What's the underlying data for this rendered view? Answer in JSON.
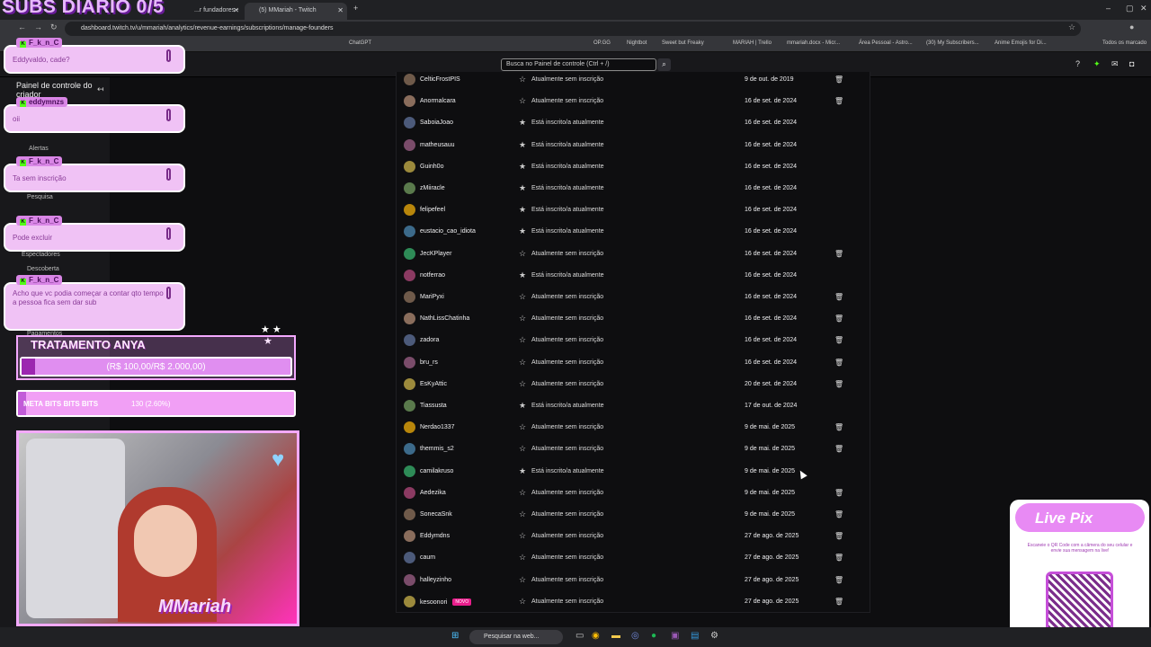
{
  "browser": {
    "tabs": [
      {
        "label": "...r fundadores - Twi"
      },
      {
        "label": "(5) MMariah - Twitch"
      }
    ],
    "url": "dashboard.twitch.tv/u/mmariah/analytics/revenue-earnings/subscriptions/manage-founders",
    "bookmarks": [
      "ChatGPT",
      "OP.GG",
      "Nightbot",
      "Sweet but Freaky",
      "MARIAH | Trello",
      "mmariah.docx - Micr...",
      "Área Pessoal - Astro...",
      "(30) My Subscribers...",
      "Anime Emojis for Di...",
      "Todos os marcado"
    ]
  },
  "dashboard": {
    "search_placeholder": "Busca no Painel de controle (Ctrl + /)",
    "sidebar": {
      "title": "Painel de controle do criador",
      "items": [
        "Alertas",
        "Pesquisa",
        "Espectadores",
        "Descoberta",
        "Pagamentos"
      ]
    },
    "rows": [
      {
        "name": "CelticFrostPIS",
        "status": "Atualmente sem inscrição",
        "date": "9 de out. de 2019",
        "filled": false,
        "trash": true
      },
      {
        "name": "Anormalcara",
        "status": "Atualmente sem inscrição",
        "date": "16 de set. de 2024",
        "filled": false,
        "trash": true
      },
      {
        "name": "SaboiaJoao",
        "status": "Está inscrito/a atualmente",
        "date": "16 de set. de 2024",
        "filled": true,
        "trash": false
      },
      {
        "name": "matheusauu",
        "status": "Está inscrito/a atualmente",
        "date": "16 de set. de 2024",
        "filled": true,
        "trash": false
      },
      {
        "name": "Guinh0o",
        "status": "Está inscrito/a atualmente",
        "date": "16 de set. de 2024",
        "filled": true,
        "trash": false
      },
      {
        "name": "zMiiracle",
        "status": "Está inscrito/a atualmente",
        "date": "16 de set. de 2024",
        "filled": true,
        "trash": false
      },
      {
        "name": "felipefeel",
        "status": "Está inscrito/a atualmente",
        "date": "16 de set. de 2024",
        "filled": true,
        "trash": false
      },
      {
        "name": "eustacio_cao_idiota",
        "status": "Está inscrito/a atualmente",
        "date": "16 de set. de 2024",
        "filled": true,
        "trash": false
      },
      {
        "name": "JecKPlayer",
        "status": "Atualmente sem inscrição",
        "date": "16 de set. de 2024",
        "filled": false,
        "trash": true
      },
      {
        "name": "notferrao",
        "status": "Está inscrito/a atualmente",
        "date": "16 de set. de 2024",
        "filled": true,
        "trash": false
      },
      {
        "name": "MariPyxi",
        "status": "Atualmente sem inscrição",
        "date": "16 de set. de 2024",
        "filled": false,
        "trash": true
      },
      {
        "name": "NathLissChatinha",
        "status": "Atualmente sem inscrição",
        "date": "16 de set. de 2024",
        "filled": false,
        "trash": true
      },
      {
        "name": "zadora",
        "status": "Atualmente sem inscrição",
        "date": "16 de set. de 2024",
        "filled": false,
        "trash": true
      },
      {
        "name": "bru_rs",
        "status": "Atualmente sem inscrição",
        "date": "16 de set. de 2024",
        "filled": false,
        "trash": true
      },
      {
        "name": "EsKyAttic",
        "status": "Atualmente sem inscrição",
        "date": "20 de set. de 2024",
        "filled": false,
        "trash": true
      },
      {
        "name": "Tiassusta",
        "status": "Está inscrito/a atualmente",
        "date": "17 de out. de 2024",
        "filled": true,
        "trash": false
      },
      {
        "name": "Nerdao1337",
        "status": "Atualmente sem inscrição",
        "date": "9 de mai. de 2025",
        "filled": false,
        "trash": true
      },
      {
        "name": "themmis_s2",
        "status": "Atualmente sem inscrição",
        "date": "9 de mai. de 2025",
        "filled": false,
        "trash": true
      },
      {
        "name": "camilakruso",
        "status": "Está inscrito/a atualmente",
        "date": "9 de mai. de 2025",
        "filled": true,
        "trash": false
      },
      {
        "name": "Aedezika",
        "status": "Atualmente sem inscrição",
        "date": "9 de mai. de 2025",
        "filled": false,
        "trash": true
      },
      {
        "name": "SonecaSnk",
        "status": "Atualmente sem inscrição",
        "date": "9 de mai. de 2025",
        "filled": false,
        "trash": true
      },
      {
        "name": "Eddymdns",
        "status": "Atualmente sem inscrição",
        "date": "27 de ago. de 2025",
        "filled": false,
        "trash": true
      },
      {
        "name": "caum",
        "status": "Atualmente sem inscrição",
        "date": "27 de ago. de 2025",
        "filled": false,
        "trash": true
      },
      {
        "name": "halleyzinho",
        "status": "Atualmente sem inscrição",
        "date": "27 de ago. de 2025",
        "filled": false,
        "trash": true
      },
      {
        "name": "kesoonori",
        "badge": "NOVO",
        "status": "Atualmente sem inscrição",
        "date": "27 de ago. de 2025",
        "filled": false,
        "trash": true
      }
    ]
  },
  "overlay": {
    "title": "SUBS DIÁRIO 0/5",
    "chat": [
      {
        "user": "F_k_n_C",
        "text": "Eddyvaldo, cade?"
      },
      {
        "user": "eddymnzs",
        "text": "oii"
      },
      {
        "user": "F_k_n_C",
        "text": "Ta sem inscrição"
      },
      {
        "user": "F_k_n_C",
        "text": "Pode excluir"
      },
      {
        "user": "F_k_n_C",
        "text": "Acho que vc podia começar a contar qto tempo a pessoa fica sem dar sub"
      }
    ],
    "goal_title": "TRATAMENTO ANYA",
    "goal_text": "(R$ 100,00/R$ 2.000,00)",
    "goal_progress": 0.05,
    "meta_label": "META BITS BITS BITS",
    "meta_value": "130 (2.60%)",
    "meta_progress": 0.026,
    "signature": "MMariah",
    "pix_title": "Live Pix",
    "pix_text": "Escaneie o QR Code com a câmera do seu celular e envie sua mensagem na live!"
  },
  "taskbar": {
    "search_placeholder": "Pesquisar na web..."
  }
}
